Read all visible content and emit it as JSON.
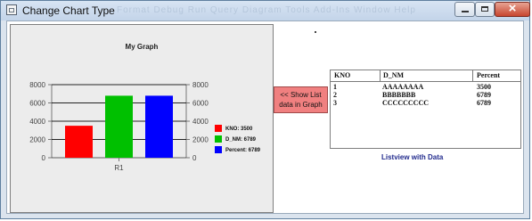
{
  "window": {
    "title": "Change Chart Type",
    "ghost_menu_text": "Format   Debug   Run   Query   Diagram   Tools   Add-Ins   Window   Help"
  },
  "chart": {
    "show_button_line1": "<< Show List",
    "show_button_line2": "data in Graph"
  },
  "chart_data": {
    "type": "bar",
    "title": "My Graph",
    "categories": [
      "R1"
    ],
    "series": [
      {
        "name": "KNO: 3500",
        "values": [
          3500
        ],
        "color": "#ff0000"
      },
      {
        "name": "D_NM: 6789",
        "values": [
          6789
        ],
        "color": "#00c000"
      },
      {
        "name": "Percent: 6789",
        "values": [
          6789
        ],
        "color": "#0000ff"
      }
    ],
    "ylim": [
      0,
      8000
    ],
    "yticks": [
      0,
      2000,
      4000,
      6000,
      8000
    ],
    "grid": true,
    "legend": "right"
  },
  "listview": {
    "columns": [
      "KNO",
      "D_NM",
      "Percent"
    ],
    "rows": [
      [
        "1",
        "AAAAAAAA",
        "3500"
      ],
      [
        "2",
        "BBBBBBB",
        "6789"
      ],
      [
        "3",
        "CCCCCCCCC",
        "6789"
      ]
    ],
    "caption": "Listview with Data"
  }
}
